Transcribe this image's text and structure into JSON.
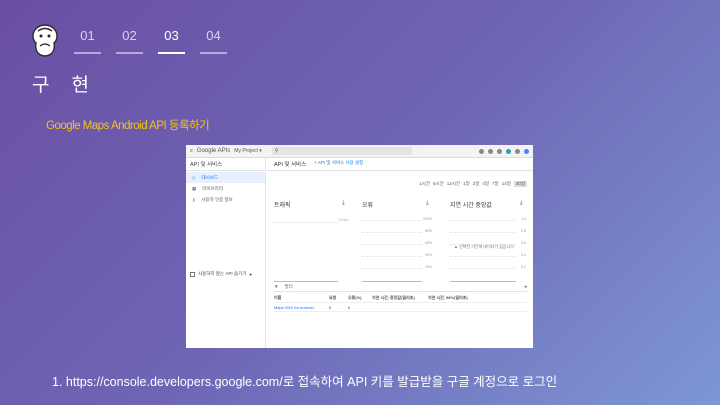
{
  "nav": {
    "steps": [
      "01",
      "02",
      "03",
      "04"
    ],
    "active_step": "03"
  },
  "title": "구 현",
  "subtitle": "Google Maps Android API 등록하기",
  "caption": "1. https://console.developers.google.com/로 접속하여 API 키를 발급받을 구글 계정으로 로그인",
  "colors": {
    "accent": "#f4c41a",
    "bg_start": "#6a4fa3",
    "bg_end": "#7d97d4",
    "link_blue": "#1a73e8"
  },
  "screenshot": {
    "topbar": {
      "brand": "Google APIs",
      "project": "My Project ▾"
    },
    "section": {
      "left": "API 및 서비스",
      "title": "API 및 서비스",
      "enable": "+ API 및 서비스 사용 설정"
    },
    "sidebar": [
      {
        "label": "대시보드",
        "icon": "dashboard-icon",
        "active": true
      },
      {
        "label": "라이브러리",
        "icon": "library-icon",
        "active": false
      },
      {
        "label": "사용자 인증 정보",
        "icon": "key-icon",
        "active": false
      }
    ],
    "ranges": [
      "1시간",
      "6시간",
      "12시간",
      "1일",
      "2일",
      "4일",
      "7일",
      "14일",
      "30일"
    ],
    "selected_range": "30일",
    "charts": [
      {
        "title": "트래픽",
        "ticks": [
          "0.01/s"
        ]
      },
      {
        "title": "오류",
        "ticks": [
          "100%",
          "80%",
          "60%",
          "40%",
          "20%"
        ]
      },
      {
        "title": "지연 시간 중앙값",
        "ticks": [
          "1.0",
          "0.8",
          "0.6",
          "0.4",
          "0.2"
        ],
        "warning": "선택된 기간에 데이터가 없습니다"
      }
    ],
    "checkbox_label": "사용하지 않는 API 숨기기",
    "filter_label": "필터",
    "table": {
      "headers": [
        "이름",
        "요청",
        "오류(%)",
        "지연 시간, 중앙값(밀리초)",
        "지연 시간, 98%(밀리초)"
      ],
      "rows": [
        [
          "Maps SDK for Android",
          "0",
          "0",
          "",
          ""
        ]
      ]
    }
  }
}
